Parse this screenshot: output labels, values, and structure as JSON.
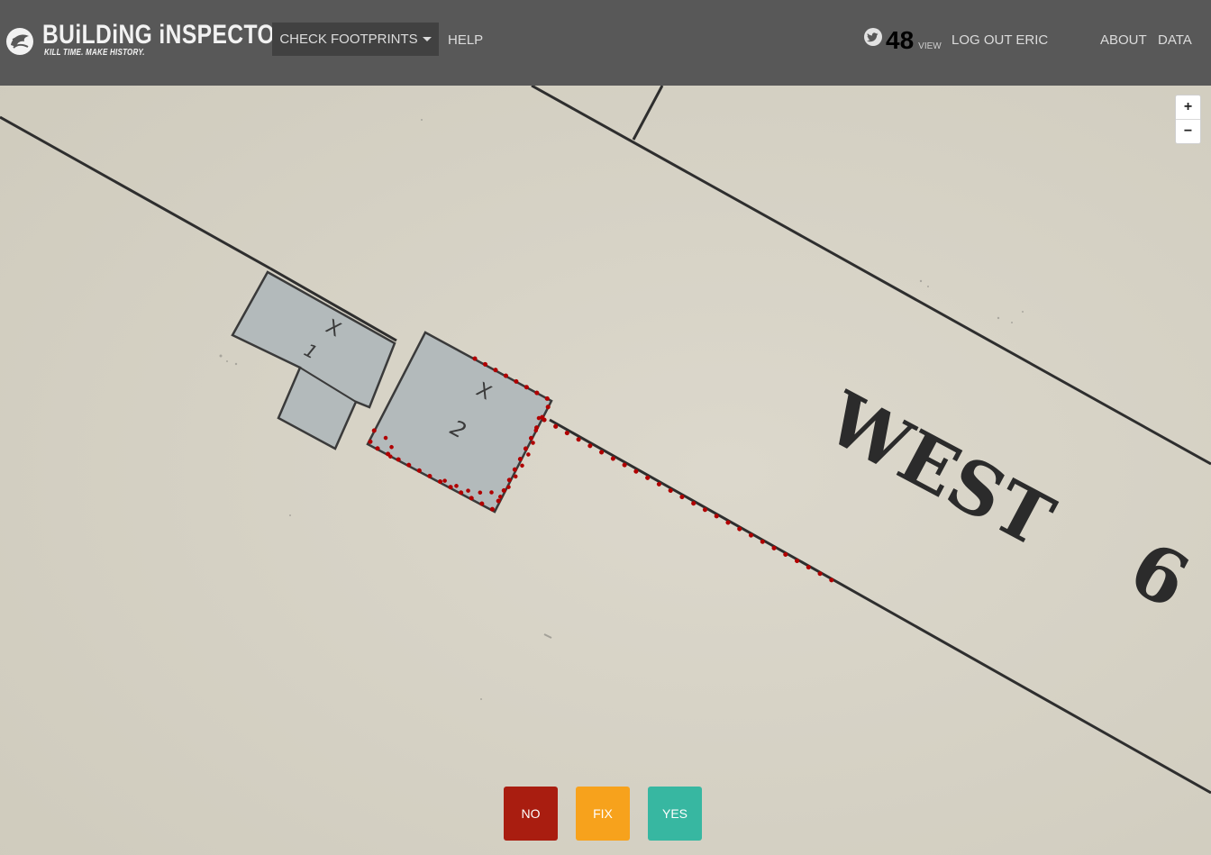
{
  "app": {
    "title": "BUiLDiNG iNSPECTOR",
    "tagline": "KILL TIME. MAKE HISTORY."
  },
  "nav": {
    "task_label": "CHECK FOOTPRINTS",
    "help": "HELP",
    "score": "48",
    "score_suffix": "VIEW",
    "logout": "LOG OUT ERIC",
    "about": "ABOUT",
    "data": "DATA"
  },
  "map": {
    "zoom_in": "+",
    "zoom_out": "−",
    "street_label_1": "WEST",
    "street_label_2": "6",
    "lot_1_marks": [
      "X",
      "1"
    ],
    "lot_2_marks": [
      "X",
      "2"
    ]
  },
  "actions": {
    "no": "NO",
    "fix": "FIX",
    "yes": "YES"
  },
  "colors": {
    "topbar": "#585858",
    "map_paper": "#d6d2c5",
    "building_fill": "#b3babb",
    "footprint_dots": "#b00000",
    "no_button": "#a91d10",
    "fix_button": "#f7a21c",
    "yes_button": "#37b7a1"
  },
  "icons": [
    "nypl-lion-icon",
    "caret-down-icon",
    "twitter-icon"
  ]
}
